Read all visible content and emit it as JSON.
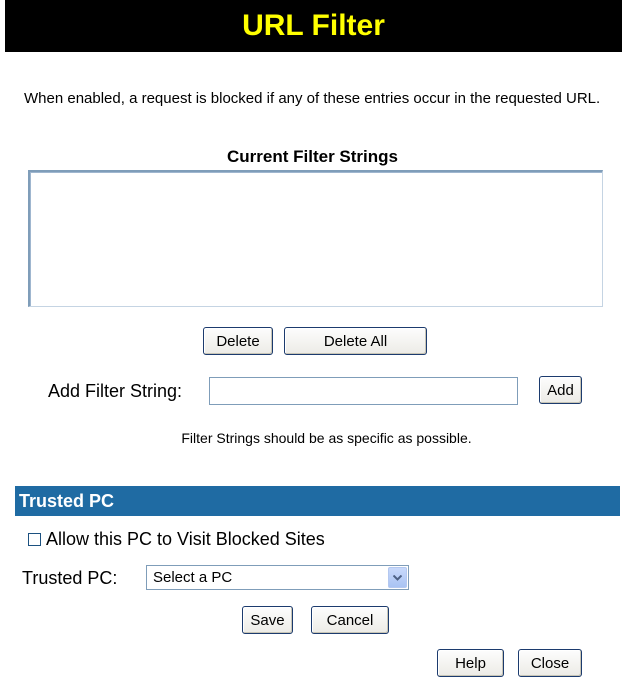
{
  "header": {
    "title": "URL Filter"
  },
  "description": "When enabled, a request is blocked if any of these entries occur in the requested URL.",
  "filter_list": {
    "heading": "Current Filter Strings",
    "items": []
  },
  "buttons": {
    "delete": "Delete",
    "delete_all": "Delete All",
    "add": "Add",
    "save": "Save",
    "cancel": "Cancel",
    "help": "Help",
    "close": "Close"
  },
  "add_filter": {
    "label": "Add Filter String:",
    "value": ""
  },
  "hint": "Filter Strings should be as specific as possible.",
  "trusted_pc": {
    "section_title": "Trusted PC",
    "checkbox_label": "Allow this PC to Visit Blocked Sites",
    "checkbox_checked": false,
    "select_label": "Trusted PC:",
    "select_value": "Select a PC"
  },
  "colors": {
    "title_bg": "#000000",
    "title_text": "#ffff00",
    "section_bg": "#1f6ba3"
  }
}
